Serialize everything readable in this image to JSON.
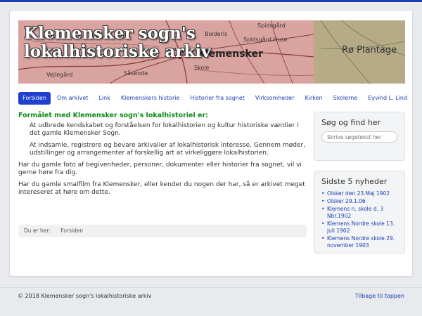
{
  "banner": {
    "title": "Klemensker sogn's lokalhistoriske arkiv"
  },
  "nav": {
    "items": [
      "Forsiden",
      "Om arkivet",
      "Link",
      "Klemenskers historie",
      "Historier fra sognet",
      "Virksomheder",
      "Kirken",
      "Skolerne",
      "Eyvind L. Lind"
    ],
    "active_index": 0
  },
  "main": {
    "heading": "Formålet med Klemensker sogn's lokalhistoriel er:",
    "indent1": "At udbrede kendskabet og forståelsen for lokalhistorien og kultur historiske værdier i det gamle Klemensker Sogn.",
    "indent2": "At indsamle, registrere og bevare arkivalier af lokalhistorisk interesse. Gennem møder, udstillinger og arrangementer af forskellig art at virkeliggøre lokalhistorien.",
    "para1": "Har du gamle foto af begivenheder, personer, dokumenter eller historier fra sognet, vil vi gerne høre fra dig.",
    "para2": "Har du gamle smalfilm fra Klemensker, eller kender du nogen der har, så er arkivet meget intereseret at høre om dette."
  },
  "breadcrumb": {
    "label": "Du er her:",
    "current": "Forsiden"
  },
  "search": {
    "title": "Søg og find her",
    "placeholder": "Skrive søgetekst her"
  },
  "news": {
    "title": "Sidste 5 nyheder",
    "items": [
      "Olsker den 23.Maj 1902",
      "Olsker 29.1.06",
      "Klemens n. skole d. 3 Nbr.1902",
      "Klemens Nordre skole 13. juli 1902",
      "Klemens Nordre skole 29. november 1903"
    ]
  },
  "footer": {
    "copyright": "© 2018 Klemensker sogn's lokalhistoriske arkiv",
    "back_to_top": "Tilbage til toppen"
  }
}
